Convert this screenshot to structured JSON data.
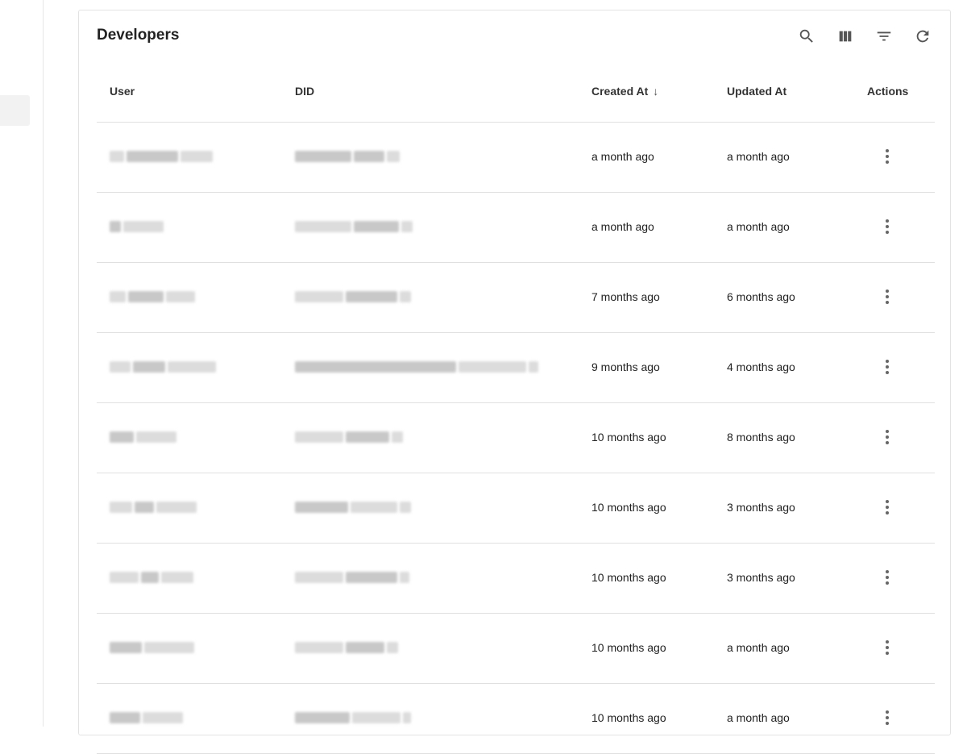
{
  "panel": {
    "title": "Developers"
  },
  "toolbar": {
    "icons": [
      "search-icon",
      "view-columns-icon",
      "filter-icon",
      "refresh-icon"
    ]
  },
  "table": {
    "columns": {
      "user": "User",
      "did": "DID",
      "created_at": "Created At",
      "updated_at": "Updated At",
      "actions": "Actions"
    },
    "sort": {
      "column": "created_at",
      "direction": "descending",
      "indicator": "↓"
    },
    "rows": [
      {
        "created_at": "a month ago",
        "updated_at": "a month ago"
      },
      {
        "created_at": "a month ago",
        "updated_at": "a month ago"
      },
      {
        "created_at": "7 months ago",
        "updated_at": "6 months ago"
      },
      {
        "created_at": "9 months ago",
        "updated_at": "4 months ago"
      },
      {
        "created_at": "10 months ago",
        "updated_at": "8 months ago"
      },
      {
        "created_at": "10 months ago",
        "updated_at": "3 months ago"
      },
      {
        "created_at": "10 months ago",
        "updated_at": "3 months ago"
      },
      {
        "created_at": "10 months ago",
        "updated_at": "a month ago"
      },
      {
        "created_at": "10 months ago",
        "updated_at": "a month ago"
      }
    ]
  },
  "colors": {
    "border": "#e0e0e0",
    "icon": "#555555",
    "redaction": "#dcdcdc"
  }
}
